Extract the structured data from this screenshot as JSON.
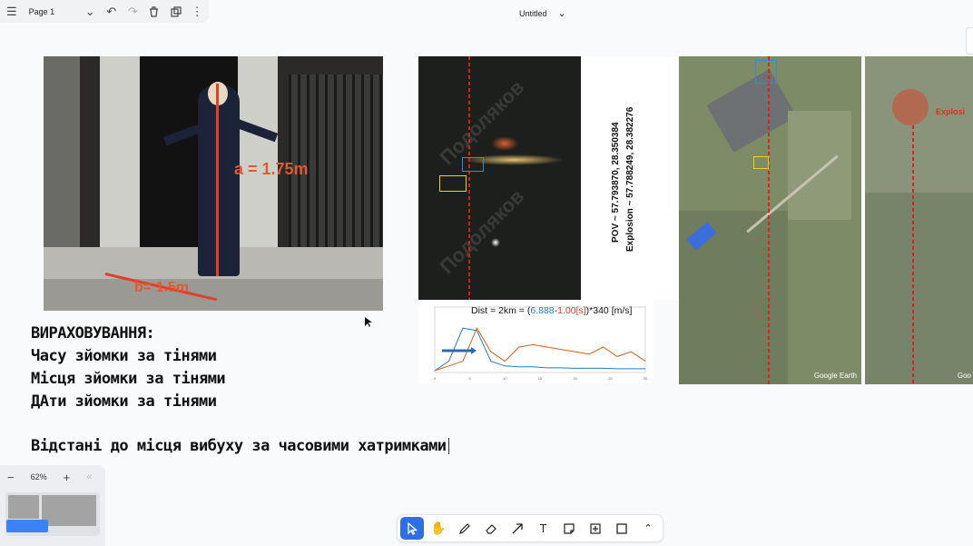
{
  "topbar": {
    "page_name": "Page 1"
  },
  "document": {
    "title": "Untitled"
  },
  "photo1": {
    "label_a": "a = 1.75m",
    "label_b": "b= 1.5m"
  },
  "notes": {
    "line1": "ВИРАХОВУВАННЯ:",
    "line2": "Часу зйомки за тінями",
    "line3": "Місця зйомки за тінями",
    "line4": "ДАти зйомки за тінями",
    "line5": "Відстані до місця вибуху за часовими хатримками"
  },
  "video": {
    "watermark": "Подоляков"
  },
  "coords": {
    "pov": "POV ~ 57.793870, 28.350384",
    "explosion": "Explosion ~ 57.788249, 28.382276"
  },
  "chart_data": {
    "type": "line",
    "title": "",
    "annotation": {
      "prefix": "Dist = 2km = (",
      "t1": "6.888",
      "sep": "-",
      "t2": "1.00[s]",
      "suffix": ")*340 [m/s]"
    },
    "x_ticks": [
      "0",
      "5",
      "10",
      "15",
      "20",
      "25",
      "30"
    ],
    "xlim": [
      0,
      30
    ],
    "series": [
      {
        "color": "#2a7ac0",
        "values": [
          0,
          0.2,
          0.9,
          0.85,
          0.2,
          0.1,
          0.08,
          0.08,
          0.06,
          0.06,
          0.05,
          0.05,
          0.05,
          0.04,
          0.04,
          0.04
        ]
      },
      {
        "color": "#d06020",
        "values": [
          0,
          0.1,
          0.2,
          0.9,
          0.4,
          0.2,
          0.5,
          0.55,
          0.5,
          0.45,
          0.4,
          0.35,
          0.5,
          0.3,
          0.4,
          0.2
        ]
      }
    ]
  },
  "maps": {
    "map1_label": "Google Earth",
    "map2_label": "Goo",
    "explosion_label": "Explosi"
  },
  "zoom": {
    "level": "62%"
  },
  "colors": {
    "accent": "#2f6fe4",
    "marker_red": "#e0402a"
  }
}
